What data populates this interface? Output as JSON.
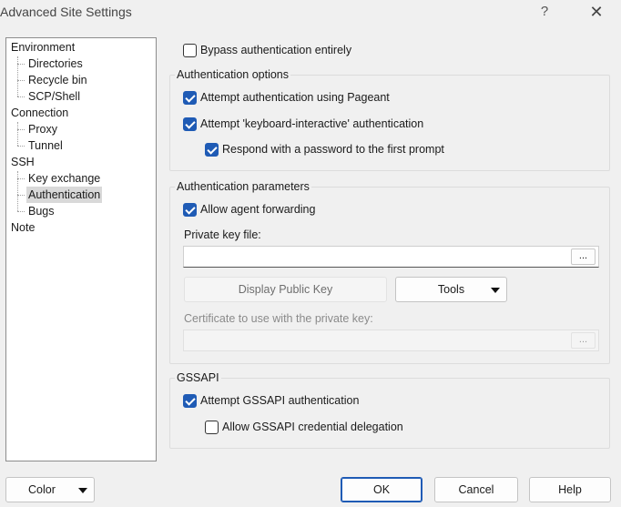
{
  "window": {
    "title": "Advanced Site Settings",
    "help_glyph": "?",
    "close_glyph": "✕"
  },
  "tree": {
    "items": [
      {
        "label": "Environment"
      },
      {
        "label": "Directories"
      },
      {
        "label": "Recycle bin"
      },
      {
        "label": "SCP/Shell"
      },
      {
        "label": "Connection"
      },
      {
        "label": "Proxy"
      },
      {
        "label": "Tunnel"
      },
      {
        "label": "SSH"
      },
      {
        "label": "Key exchange"
      },
      {
        "label": "Authentication"
      },
      {
        "label": "Bugs"
      },
      {
        "label": "Note"
      }
    ],
    "selected": "Authentication"
  },
  "main": {
    "bypass": {
      "label": "Bypass authentication entirely",
      "checked": false
    },
    "auth_options": {
      "title": "Authentication options",
      "pageant": {
        "label": "Attempt authentication using Pageant",
        "checked": true
      },
      "keyboard_interactive": {
        "label": "Attempt 'keyboard-interactive' authentication",
        "checked": true
      },
      "respond_password": {
        "label": "Respond with a password to the first prompt",
        "checked": true
      }
    },
    "auth_params": {
      "title": "Authentication parameters",
      "agent_forwarding": {
        "label": "Allow agent forwarding",
        "checked": true
      },
      "private_key_label": "Private key file:",
      "private_key_value": "",
      "browse_label": "...",
      "display_public_key": "Display Public Key",
      "tools": "Tools",
      "certificate_label": "Certificate to use with the private key:",
      "certificate_value": "",
      "certificate_browse": "..."
    },
    "gssapi": {
      "title": "GSSAPI",
      "attempt": {
        "label": "Attempt GSSAPI authentication",
        "checked": true
      },
      "delegation": {
        "label": "Allow GSSAPI credential delegation",
        "checked": false
      }
    }
  },
  "footer": {
    "color": "Color",
    "ok": "OK",
    "cancel": "Cancel",
    "help": "Help"
  },
  "colors": {
    "accent": "#1f5bb5",
    "selected_item": "#d9d9d9",
    "background": "#f0f0f0"
  }
}
